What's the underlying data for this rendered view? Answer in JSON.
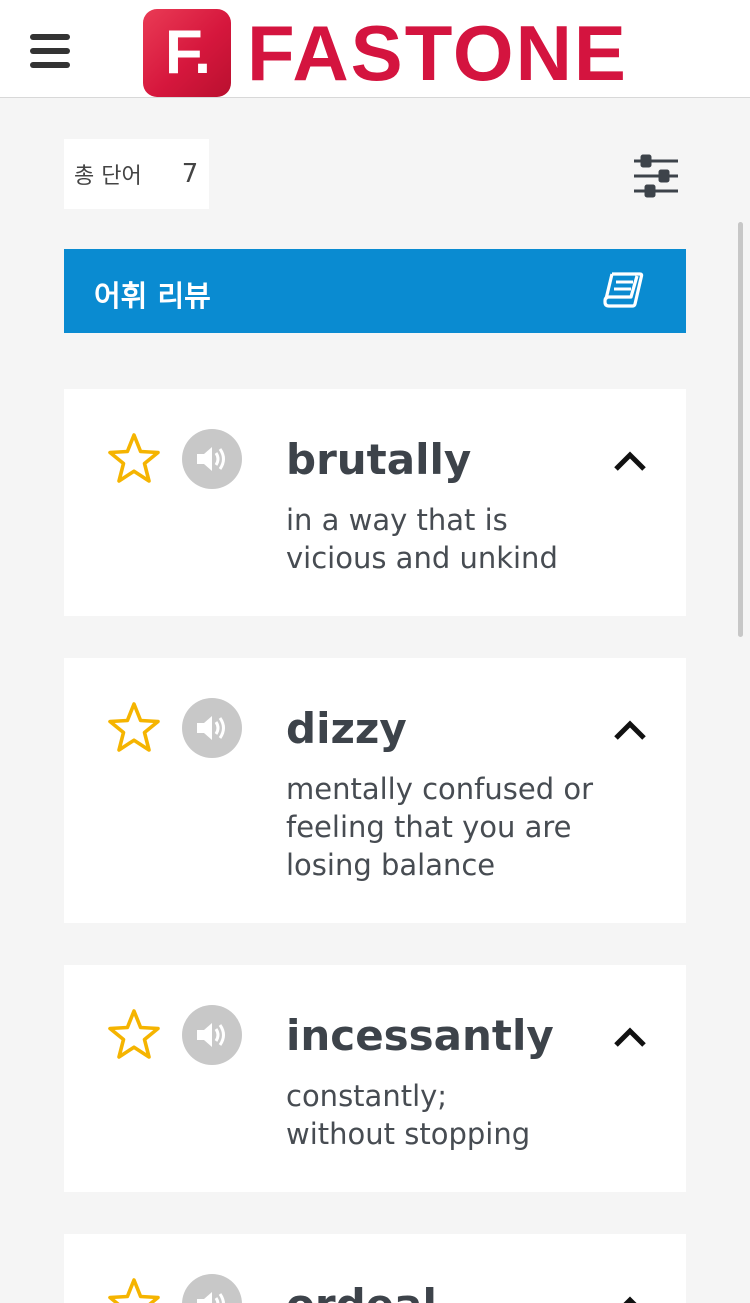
{
  "header": {
    "logo_mark": "F.",
    "logo_text": "FASTONE",
    "brand_color": "#d4143f"
  },
  "summary": {
    "total_label": "총 단어",
    "total_value": "7"
  },
  "review_bar": {
    "label": "어휘 리뷰",
    "color": "#0a8bd1",
    "icon": "book-icon"
  },
  "words": [
    {
      "word": "brutally",
      "definition_lines": [
        "in a way that is",
        "vicious and unkind"
      ]
    },
    {
      "word": "dizzy",
      "definition_lines": [
        "mentally confused or",
        "feeling that you are",
        "losing balance"
      ]
    },
    {
      "word": "incessantly",
      "definition_lines": [
        "constantly;",
        "without stopping"
      ]
    },
    {
      "word": "ordeal",
      "definition_lines": []
    }
  ],
  "icons": {
    "menu": "hamburger-icon",
    "filter": "sliders-icon",
    "favorite": "star-outline-icon",
    "audio": "speaker-icon",
    "toggle": "chevron-up-icon",
    "star_color": "#f5b400"
  }
}
